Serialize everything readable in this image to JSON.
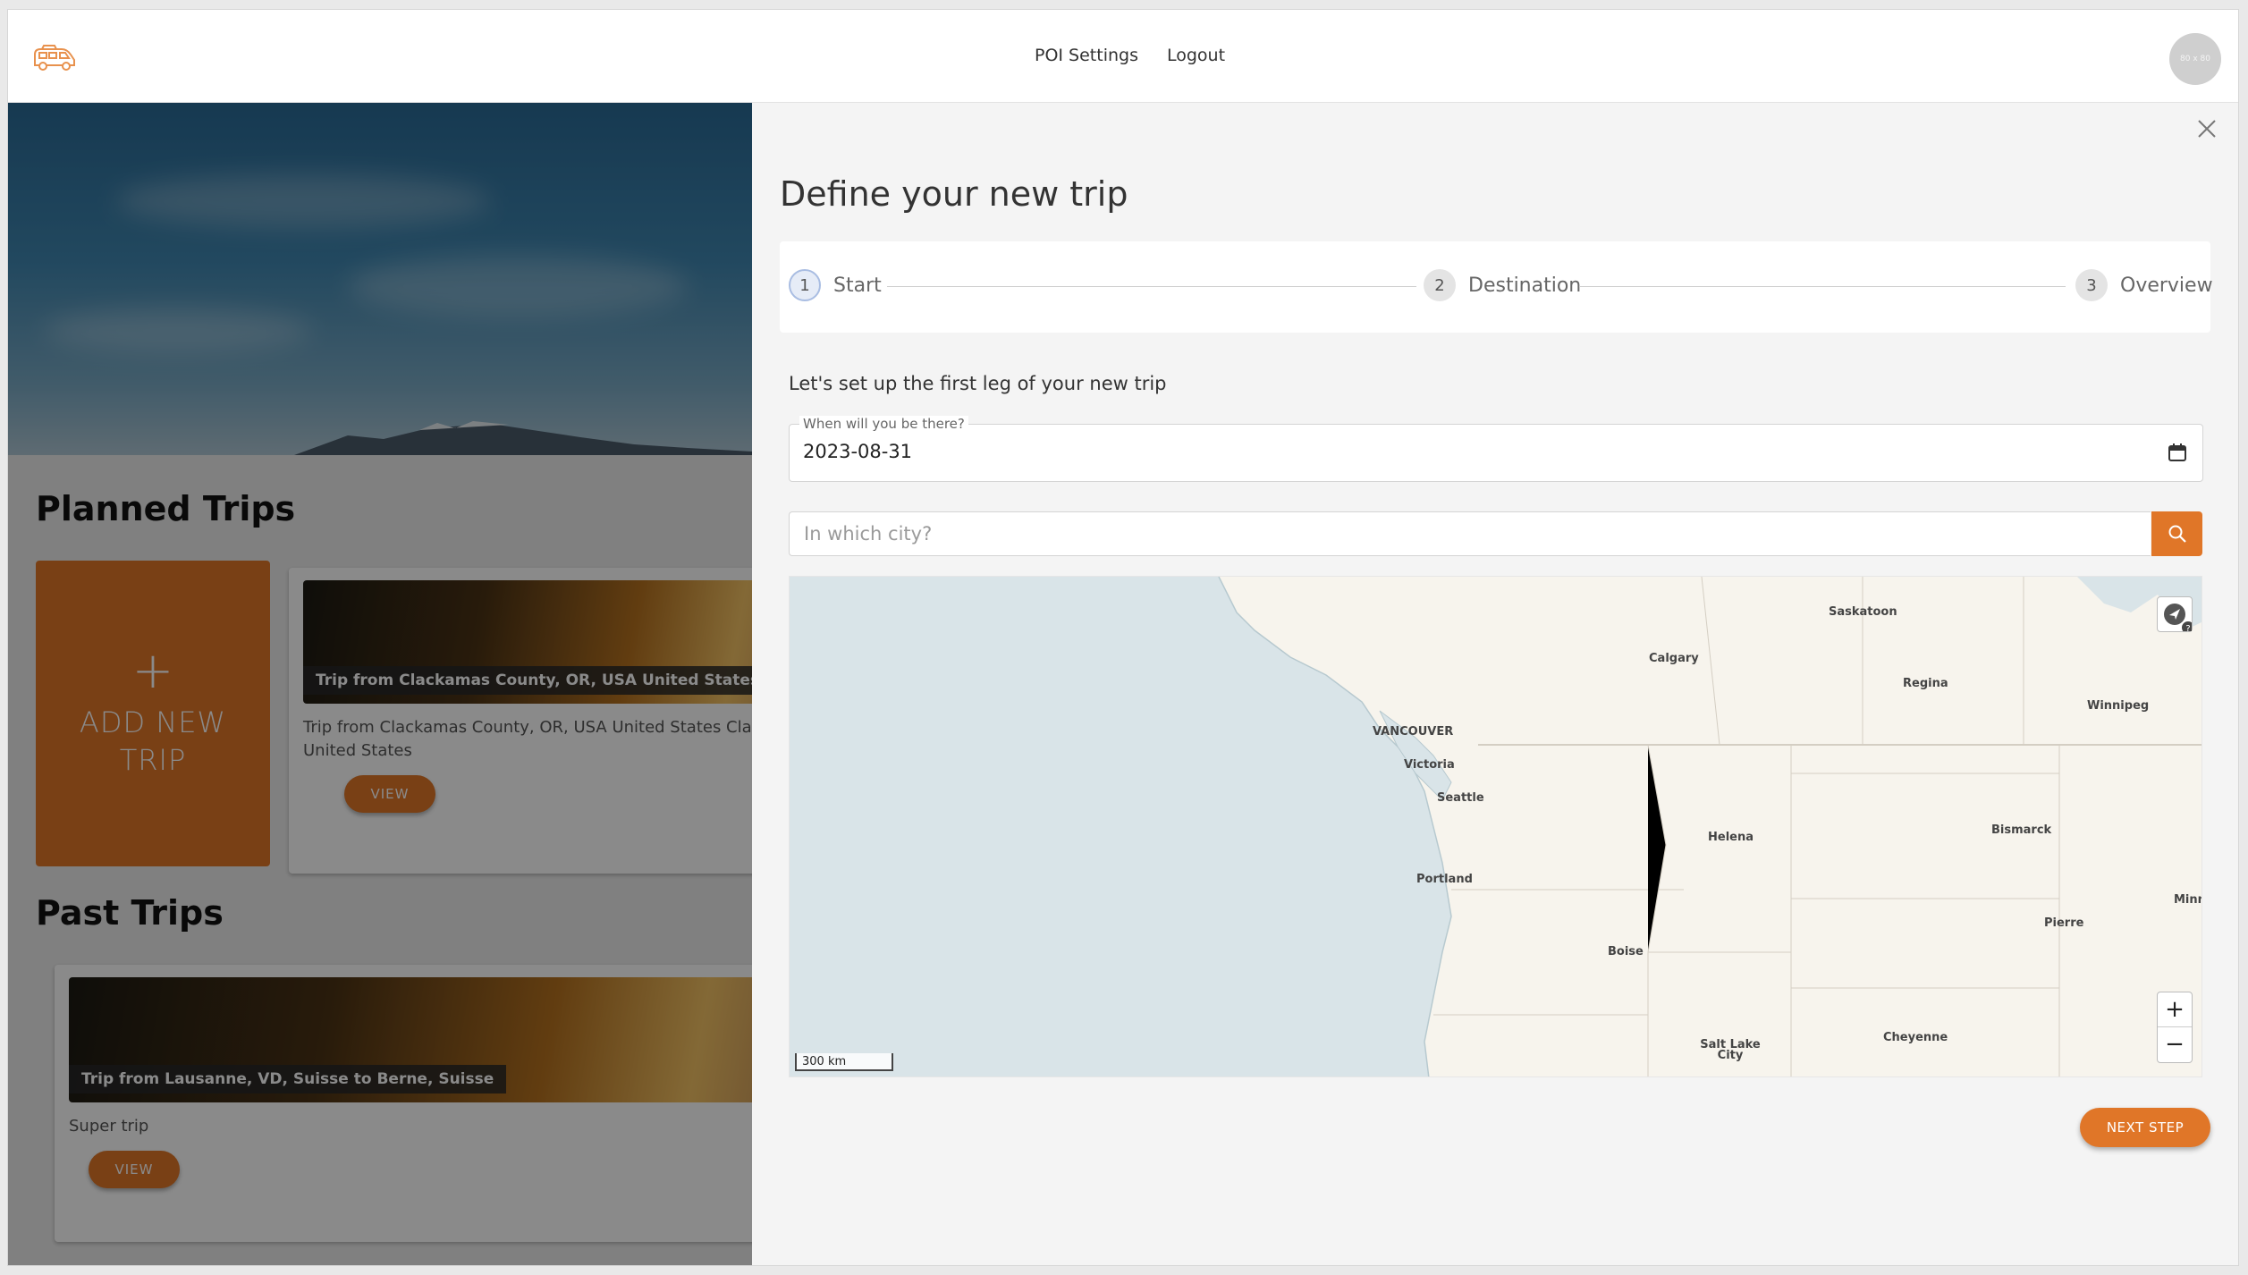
{
  "nav": {
    "links": [
      "POI Settings",
      "Logout"
    ],
    "avatar_text": "80 x 80"
  },
  "left": {
    "planned_title": "Planned Trips",
    "add_card": {
      "icon": "+",
      "label": "ADD NEW TRIP"
    },
    "planned_trip": {
      "image_label": "Trip from Clackamas County, OR, USA United States Clack",
      "description": "Trip from Clackamas County, OR, USA United States Clack United States",
      "view_label": "VIEW"
    },
    "past_title": "Past Trips",
    "past_trip": {
      "image_label": "Trip from Lausanne, VD, Suisse to Berne, Suisse",
      "description": "Super trip",
      "view_label": "VIEW"
    }
  },
  "drawer": {
    "title": "Define your new trip",
    "steps": [
      {
        "number": "1",
        "label": "Start"
      },
      {
        "number": "2",
        "label": "Destination"
      },
      {
        "number": "3",
        "label": "Overview"
      }
    ],
    "intro": "Let's set up the first leg of your new trip",
    "date_field": {
      "label": "When will you be there?",
      "value": "2023-08-31"
    },
    "city_input": {
      "placeholder": "In which city?",
      "value": ""
    },
    "map": {
      "scale_label": "300 km",
      "cities": [
        {
          "name": "Saskatoon"
        },
        {
          "name": "Calgary"
        },
        {
          "name": "Regina"
        },
        {
          "name": "Winnipeg"
        },
        {
          "name": "VANCOUVER"
        },
        {
          "name": "Victoria"
        },
        {
          "name": "Seattle"
        },
        {
          "name": "Helena"
        },
        {
          "name": "Bismarck"
        },
        {
          "name": "Portland"
        },
        {
          "name": "Pierre"
        },
        {
          "name": "Minn"
        },
        {
          "name": "Boise"
        },
        {
          "name": "Cheyenne"
        },
        {
          "name": "Salt Lake City"
        }
      ],
      "zoom_in": "+",
      "zoom_out": "−"
    },
    "next_label": "NEXT STEP"
  },
  "colors": {
    "accent": "#e07628",
    "drawer_bg": "#f4f4f4",
    "water": "#d9e4e8",
    "land": "#f7f4ed"
  }
}
